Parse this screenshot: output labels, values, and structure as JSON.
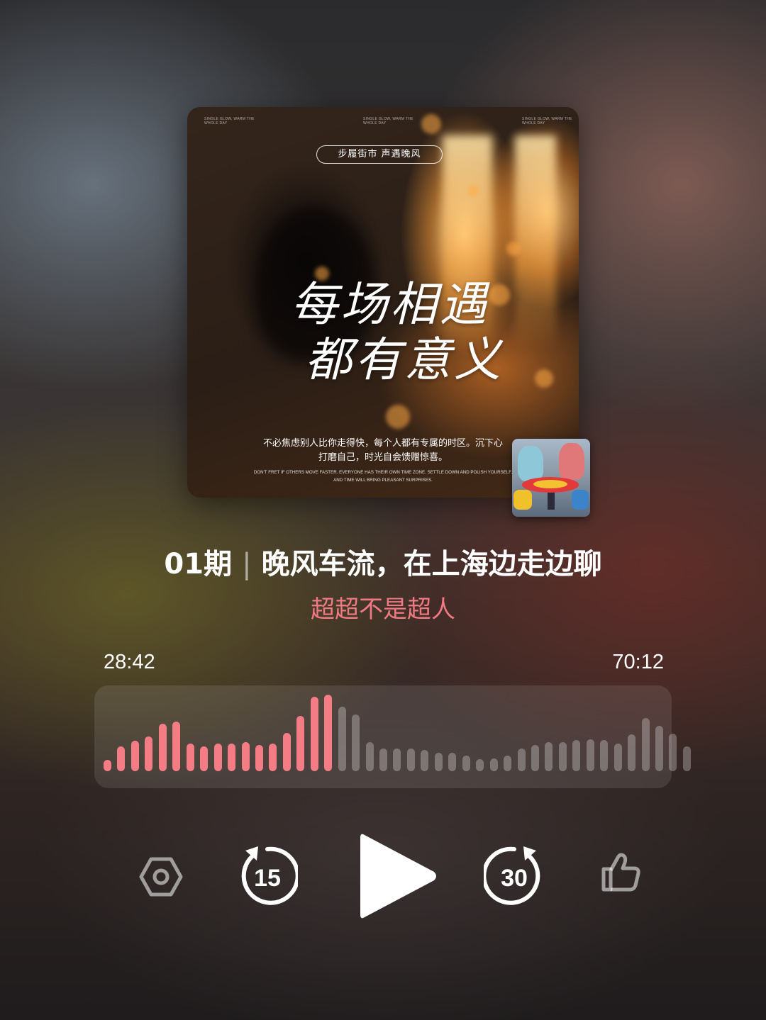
{
  "cover": {
    "top_notes": [
      "SINGLE GLOW, WARM THE\nWHOLE DAY",
      "SINGLE GLOW, WARM THE\nWHOLE DAY",
      "SINGLE GLOW, WARM THE\nWHOLE DAY"
    ],
    "tag": "步履街市  声遇晚风",
    "title_line1": "每场相遇",
    "title_line2": "都有意义",
    "quote_line1": "不必焦虑别人比你走得快，每个人都有专属的时区。沉下心",
    "quote_line2": "打磨自己，时光自会馈赠惊喜。",
    "quote_en_line1": "DON'T FRET IF OTHERS MOVE FASTER. EVERYONE HAS THEIR OWN TIME ZONE. SETTLE DOWN AND POLISH YOURSELF,",
    "quote_en_line2": "AND TIME WILL BRING PLEASANT SURPRISES."
  },
  "episode": {
    "number": "01期",
    "separator": "|",
    "title": "晚风车流，在上海边走边聊",
    "author": "超超不是超人"
  },
  "player": {
    "elapsed": "28:42",
    "total": "70:12",
    "progress_fraction": 0.409,
    "waveform": [
      0.15,
      0.32,
      0.4,
      0.45,
      0.62,
      0.65,
      0.36,
      0.32,
      0.36,
      0.36,
      0.38,
      0.34,
      0.36,
      0.5,
      0.72,
      0.97,
      1.0,
      0.84,
      0.74,
      0.38,
      0.3,
      0.3,
      0.3,
      0.28,
      0.24,
      0.24,
      0.2,
      0.16,
      0.17,
      0.2,
      0.3,
      0.34,
      0.38,
      0.38,
      0.41,
      0.42,
      0.41,
      0.36,
      0.48,
      0.69,
      0.59,
      0.49,
      0.32
    ],
    "played_bars": 17,
    "skip_back_seconds": "15",
    "skip_forward_seconds": "30"
  },
  "icons": {
    "settings": "hexagon-settings-icon",
    "rewind": "rewind-15-icon",
    "play": "play-icon",
    "forward": "forward-30-icon",
    "like": "thumbs-up-icon"
  },
  "colors": {
    "accent": "#f37c85",
    "author": "#f07a84"
  }
}
